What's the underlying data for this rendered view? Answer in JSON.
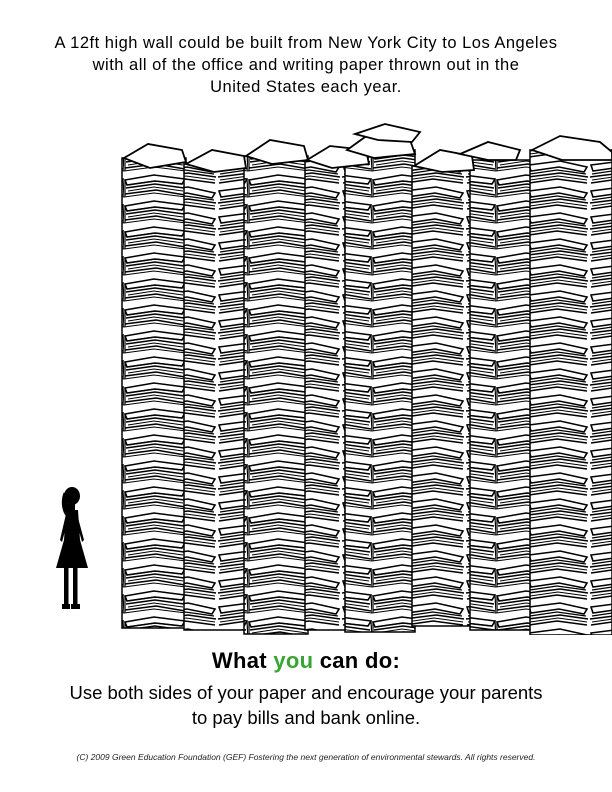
{
  "headline": {
    "line1": "A 12ft high wall could be built from New York City to Los Angeles",
    "line2": "with all of the office and writing paper thrown out in the",
    "line3": "United States each year."
  },
  "illustration": {
    "subject": "paper-wall",
    "figure": "child-silhouette"
  },
  "cta": {
    "heading_pre": "What ",
    "heading_accent": "you",
    "heading_post": " can do:",
    "accent_color": "#3aa537",
    "line1": "Use both sides of your paper and encourage your parents",
    "line2": "to pay bills and bank online."
  },
  "footer": {
    "copyright": "(C) 2009 Green Education Foundation (GEF) Fostering the next generation of environmental stewards.  All rights reserved."
  }
}
